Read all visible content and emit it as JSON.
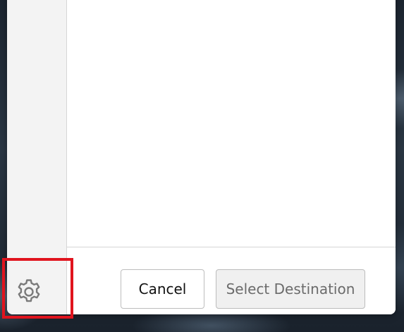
{
  "footer": {
    "cancel_label": "Cancel",
    "select_destination_label": "Select Destination"
  },
  "sidebar": {
    "settings_icon": "gear-icon"
  },
  "colors": {
    "highlight": "#e0141e",
    "sidebar_bg": "#f3f3f3",
    "button_disabled_text": "#6b6b6b"
  }
}
